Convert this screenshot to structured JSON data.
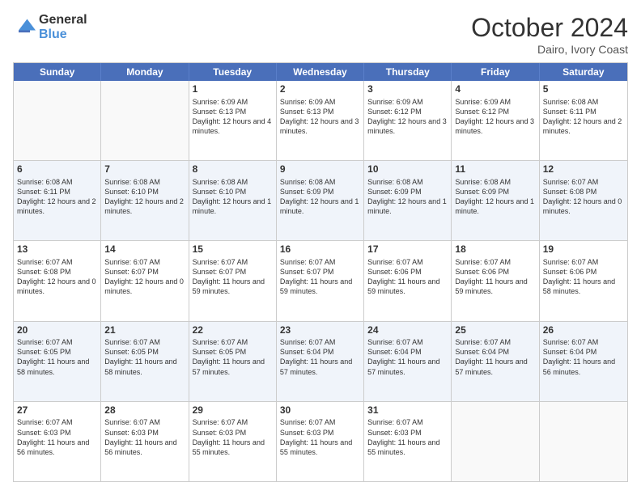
{
  "logo": {
    "general": "General",
    "blue": "Blue"
  },
  "header": {
    "month": "October 2024",
    "location": "Dairo, Ivory Coast"
  },
  "weekdays": [
    "Sunday",
    "Monday",
    "Tuesday",
    "Wednesday",
    "Thursday",
    "Friday",
    "Saturday"
  ],
  "rows": [
    {
      "cells": [
        {
          "day": "",
          "empty": true
        },
        {
          "day": "",
          "empty": true
        },
        {
          "day": "1",
          "sunrise": "Sunrise: 6:09 AM",
          "sunset": "Sunset: 6:13 PM",
          "daylight": "Daylight: 12 hours and 4 minutes."
        },
        {
          "day": "2",
          "sunrise": "Sunrise: 6:09 AM",
          "sunset": "Sunset: 6:13 PM",
          "daylight": "Daylight: 12 hours and 3 minutes."
        },
        {
          "day": "3",
          "sunrise": "Sunrise: 6:09 AM",
          "sunset": "Sunset: 6:12 PM",
          "daylight": "Daylight: 12 hours and 3 minutes."
        },
        {
          "day": "4",
          "sunrise": "Sunrise: 6:09 AM",
          "sunset": "Sunset: 6:12 PM",
          "daylight": "Daylight: 12 hours and 3 minutes."
        },
        {
          "day": "5",
          "sunrise": "Sunrise: 6:08 AM",
          "sunset": "Sunset: 6:11 PM",
          "daylight": "Daylight: 12 hours and 2 minutes."
        }
      ]
    },
    {
      "alt": true,
      "cells": [
        {
          "day": "6",
          "sunrise": "Sunrise: 6:08 AM",
          "sunset": "Sunset: 6:11 PM",
          "daylight": "Daylight: 12 hours and 2 minutes."
        },
        {
          "day": "7",
          "sunrise": "Sunrise: 6:08 AM",
          "sunset": "Sunset: 6:10 PM",
          "daylight": "Daylight: 12 hours and 2 minutes."
        },
        {
          "day": "8",
          "sunrise": "Sunrise: 6:08 AM",
          "sunset": "Sunset: 6:10 PM",
          "daylight": "Daylight: 12 hours and 1 minute."
        },
        {
          "day": "9",
          "sunrise": "Sunrise: 6:08 AM",
          "sunset": "Sunset: 6:09 PM",
          "daylight": "Daylight: 12 hours and 1 minute."
        },
        {
          "day": "10",
          "sunrise": "Sunrise: 6:08 AM",
          "sunset": "Sunset: 6:09 PM",
          "daylight": "Daylight: 12 hours and 1 minute."
        },
        {
          "day": "11",
          "sunrise": "Sunrise: 6:08 AM",
          "sunset": "Sunset: 6:09 PM",
          "daylight": "Daylight: 12 hours and 1 minute."
        },
        {
          "day": "12",
          "sunrise": "Sunrise: 6:07 AM",
          "sunset": "Sunset: 6:08 PM",
          "daylight": "Daylight: 12 hours and 0 minutes."
        }
      ]
    },
    {
      "cells": [
        {
          "day": "13",
          "sunrise": "Sunrise: 6:07 AM",
          "sunset": "Sunset: 6:08 PM",
          "daylight": "Daylight: 12 hours and 0 minutes."
        },
        {
          "day": "14",
          "sunrise": "Sunrise: 6:07 AM",
          "sunset": "Sunset: 6:07 PM",
          "daylight": "Daylight: 12 hours and 0 minutes."
        },
        {
          "day": "15",
          "sunrise": "Sunrise: 6:07 AM",
          "sunset": "Sunset: 6:07 PM",
          "daylight": "Daylight: 11 hours and 59 minutes."
        },
        {
          "day": "16",
          "sunrise": "Sunrise: 6:07 AM",
          "sunset": "Sunset: 6:07 PM",
          "daylight": "Daylight: 11 hours and 59 minutes."
        },
        {
          "day": "17",
          "sunrise": "Sunrise: 6:07 AM",
          "sunset": "Sunset: 6:06 PM",
          "daylight": "Daylight: 11 hours and 59 minutes."
        },
        {
          "day": "18",
          "sunrise": "Sunrise: 6:07 AM",
          "sunset": "Sunset: 6:06 PM",
          "daylight": "Daylight: 11 hours and 59 minutes."
        },
        {
          "day": "19",
          "sunrise": "Sunrise: 6:07 AM",
          "sunset": "Sunset: 6:06 PM",
          "daylight": "Daylight: 11 hours and 58 minutes."
        }
      ]
    },
    {
      "alt": true,
      "cells": [
        {
          "day": "20",
          "sunrise": "Sunrise: 6:07 AM",
          "sunset": "Sunset: 6:05 PM",
          "daylight": "Daylight: 11 hours and 58 minutes."
        },
        {
          "day": "21",
          "sunrise": "Sunrise: 6:07 AM",
          "sunset": "Sunset: 6:05 PM",
          "daylight": "Daylight: 11 hours and 58 minutes."
        },
        {
          "day": "22",
          "sunrise": "Sunrise: 6:07 AM",
          "sunset": "Sunset: 6:05 PM",
          "daylight": "Daylight: 11 hours and 57 minutes."
        },
        {
          "day": "23",
          "sunrise": "Sunrise: 6:07 AM",
          "sunset": "Sunset: 6:04 PM",
          "daylight": "Daylight: 11 hours and 57 minutes."
        },
        {
          "day": "24",
          "sunrise": "Sunrise: 6:07 AM",
          "sunset": "Sunset: 6:04 PM",
          "daylight": "Daylight: 11 hours and 57 minutes."
        },
        {
          "day": "25",
          "sunrise": "Sunrise: 6:07 AM",
          "sunset": "Sunset: 6:04 PM",
          "daylight": "Daylight: 11 hours and 57 minutes."
        },
        {
          "day": "26",
          "sunrise": "Sunrise: 6:07 AM",
          "sunset": "Sunset: 6:04 PM",
          "daylight": "Daylight: 11 hours and 56 minutes."
        }
      ]
    },
    {
      "cells": [
        {
          "day": "27",
          "sunrise": "Sunrise: 6:07 AM",
          "sunset": "Sunset: 6:03 PM",
          "daylight": "Daylight: 11 hours and 56 minutes."
        },
        {
          "day": "28",
          "sunrise": "Sunrise: 6:07 AM",
          "sunset": "Sunset: 6:03 PM",
          "daylight": "Daylight: 11 hours and 56 minutes."
        },
        {
          "day": "29",
          "sunrise": "Sunrise: 6:07 AM",
          "sunset": "Sunset: 6:03 PM",
          "daylight": "Daylight: 11 hours and 55 minutes."
        },
        {
          "day": "30",
          "sunrise": "Sunrise: 6:07 AM",
          "sunset": "Sunset: 6:03 PM",
          "daylight": "Daylight: 11 hours and 55 minutes."
        },
        {
          "day": "31",
          "sunrise": "Sunrise: 6:07 AM",
          "sunset": "Sunset: 6:03 PM",
          "daylight": "Daylight: 11 hours and 55 minutes."
        },
        {
          "day": "",
          "empty": true
        },
        {
          "day": "",
          "empty": true
        }
      ]
    }
  ]
}
